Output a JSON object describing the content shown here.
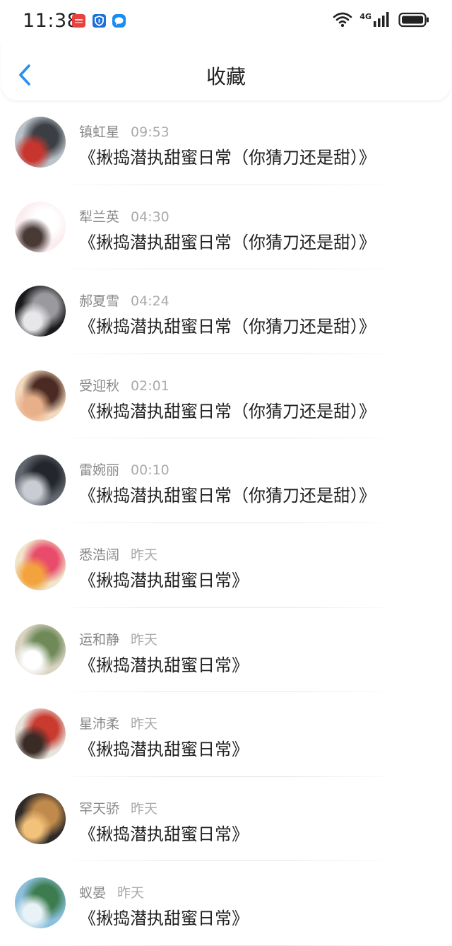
{
  "status_bar": {
    "time": "11:38",
    "network": "4G"
  },
  "header": {
    "title": "收藏"
  },
  "items": [
    {
      "user": "镇虹星",
      "time": "09:53",
      "title": "《揪捣潜执甜蜜日常（你猜刀还是甜）》",
      "avatar": "car-avatar",
      "colors": [
        "#b9c3c9",
        "#3b3f44",
        "#c8352f"
      ]
    },
    {
      "user": "犁兰英",
      "time": "04:30",
      "title": "《揪捣潜执甜蜜日常（你猜刀还是甜）》",
      "avatar": "cat-avatar",
      "colors": [
        "#fbecef",
        "#ffffff",
        "#4a3a35"
      ]
    },
    {
      "user": "郝夏雪",
      "time": "04:24",
      "title": "《揪捣潜执甜蜜日常（你猜刀还是甜）》",
      "avatar": "anime-avatar",
      "colors": [
        "#1a1a1c",
        "#9a9a9e",
        "#e7e7ea"
      ]
    },
    {
      "user": "受迎秋",
      "time": "02:01",
      "title": "《揪捣潜执甜蜜日常（你猜刀还是甜）》",
      "avatar": "couple-avatar",
      "colors": [
        "#f4d9bd",
        "#4a2a22",
        "#e8b08a"
      ]
    },
    {
      "user": "雷婉丽",
      "time": "00:10",
      "title": "《揪捣潜执甜蜜日常（你猜刀还是甜）》",
      "avatar": "girl-avatar",
      "colors": [
        "#62666e",
        "#23262c",
        "#c9ccd3"
      ]
    },
    {
      "user": "悉浩阔",
      "time": "昨天",
      "title": "《揪捣潜执甜蜜日常》",
      "avatar": "straws-avatar",
      "colors": [
        "#f1e4c9",
        "#e84b6b",
        "#f2a33d"
      ]
    },
    {
      "user": "运和静",
      "time": "昨天",
      "title": "《揪捣潜执甜蜜日常》",
      "avatar": "field-avatar",
      "colors": [
        "#d9d3c2",
        "#6f8a58",
        "#ffffff"
      ]
    },
    {
      "user": "星沛柔",
      "time": "昨天",
      "title": "《揪捣潜执甜蜜日常》",
      "avatar": "red-girl-avatar",
      "colors": [
        "#e7e4dc",
        "#c93a2f",
        "#3a2b26"
      ]
    },
    {
      "user": "罕天骄",
      "time": "昨天",
      "title": "《揪捣潜执甜蜜日常》",
      "avatar": "sunset-avatar",
      "colors": [
        "#2f2a28",
        "#c08a4c",
        "#f3c27a"
      ]
    },
    {
      "user": "蚁晏",
      "time": "昨天",
      "title": "《揪捣潜执甜蜜日常》",
      "avatar": "island-avatar",
      "colors": [
        "#8cc0de",
        "#3d7c4e",
        "#e9f3f7"
      ]
    }
  ]
}
